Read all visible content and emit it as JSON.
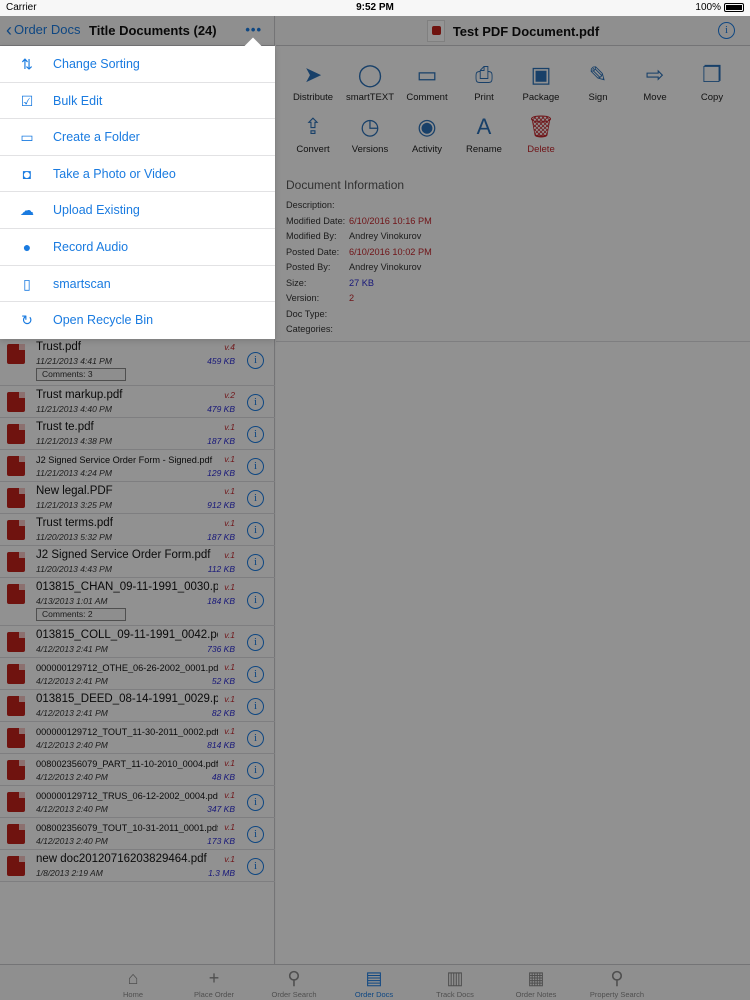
{
  "status": {
    "carrier": "Carrier",
    "time": "9:52 PM",
    "battery": "100%"
  },
  "left_nav": {
    "back_label": "Order Docs",
    "title": "Title Documents (24)",
    "more": "•••"
  },
  "menu": [
    {
      "label": "Change Sorting",
      "icon": "sort-icon"
    },
    {
      "label": "Bulk Edit",
      "icon": "edit-icon"
    },
    {
      "label": "Create a Folder",
      "icon": "folder-icon"
    },
    {
      "label": "Take a Photo or Video",
      "icon": "camera-icon"
    },
    {
      "label": "Upload Existing",
      "icon": "cloud-upload-icon"
    },
    {
      "label": "Record Audio",
      "icon": "microphone-icon"
    },
    {
      "label": "smartscan",
      "icon": "phone-icon"
    },
    {
      "label": "Open Recycle Bin",
      "icon": "recycle-icon"
    }
  ],
  "documents": [
    {
      "name": "Trust.pdf",
      "date": "11/21/2013 4:41 PM",
      "version": "v.4",
      "size": "459 KB",
      "comments": "Comments: 3"
    },
    {
      "name": "Trust markup.pdf",
      "date": "11/21/2013 4:40 PM",
      "version": "v.2",
      "size": "479 KB"
    },
    {
      "name": "Trust te.pdf",
      "date": "11/21/2013 4:38 PM",
      "version": "v.1",
      "size": "187 KB"
    },
    {
      "name": "J2 Signed Service Order Form - Signed.pdf",
      "date": "11/21/2013 4:24 PM",
      "version": "v.1",
      "size": "129 KB",
      "small": true
    },
    {
      "name": "New legal.PDF",
      "date": "11/21/2013 3:25 PM",
      "version": "v.1",
      "size": "912 KB"
    },
    {
      "name": "Trust terms.pdf",
      "date": "11/20/2013 5:32 PM",
      "version": "v.1",
      "size": "187 KB"
    },
    {
      "name": "J2 Signed Service Order Form.pdf",
      "date": "11/20/2013 4:43 PM",
      "version": "v.1",
      "size": "112 KB"
    },
    {
      "name": "013815_CHAN_09-11-1991_0030.pdf",
      "date": "4/13/2013 1:01 AM",
      "version": "v.1",
      "size": "184 KB",
      "comments": "Comments: 2"
    },
    {
      "name": "013815_COLL_09-11-1991_0042.pdf",
      "date": "4/12/2013 2:41 PM",
      "version": "v.1",
      "size": "736 KB"
    },
    {
      "name": "000000129712_OTHE_06-26-2002_0001.pdf",
      "date": "4/12/2013 2:41 PM",
      "version": "v.1",
      "size": "52 KB",
      "small": true
    },
    {
      "name": "013815_DEED_08-14-1991_0029.pdf",
      "date": "4/12/2013 2:41 PM",
      "version": "v.1",
      "size": "82 KB"
    },
    {
      "name": "000000129712_TOUT_11-30-2011_0002.pdf",
      "date": "4/12/2013 2:40 PM",
      "version": "v.1",
      "size": "814 KB",
      "small": true
    },
    {
      "name": "008002356079_PART_11-10-2010_0004.pdf",
      "date": "4/12/2013 2:40 PM",
      "version": "v.1",
      "size": "48 KB",
      "small": true
    },
    {
      "name": "000000129712_TRUS_06-12-2002_0004.pdf",
      "date": "4/12/2013 2:40 PM",
      "version": "v.1",
      "size": "347 KB",
      "small": true
    },
    {
      "name": "008002356079_TOUT_10-31-2011_0001.pdf",
      "date": "4/12/2013 2:40 PM",
      "version": "v.1",
      "size": "173 KB",
      "small": true
    },
    {
      "name": "new doc20120716203829464.pdf",
      "date": "1/8/2013 2:19 AM",
      "version": "v.1",
      "size": "1.3 MB"
    }
  ],
  "right_nav": {
    "doc_title": "Test PDF Document.pdf"
  },
  "tools": [
    {
      "label": "Distribute",
      "icon": "paper-plane-icon",
      "glyph": "➤"
    },
    {
      "label": "smartTEXT",
      "icon": "chat-bubble-icon",
      "glyph": "◯"
    },
    {
      "label": "Comment",
      "icon": "comment-icon",
      "glyph": "▭"
    },
    {
      "label": "Print",
      "icon": "printer-icon",
      "glyph": "⎙"
    },
    {
      "label": "Package",
      "icon": "briefcase-icon",
      "glyph": "▣"
    },
    {
      "label": "Sign",
      "icon": "pen-icon",
      "glyph": "✎"
    },
    {
      "label": "Move",
      "icon": "move-icon",
      "glyph": "⇨"
    },
    {
      "label": "Copy",
      "icon": "copy-icon",
      "glyph": "❐"
    },
    {
      "label": "Convert",
      "icon": "share-icon",
      "glyph": "⇪"
    },
    {
      "label": "Versions",
      "icon": "clock-icon",
      "glyph": "◷"
    },
    {
      "label": "Activity",
      "icon": "eye-icon",
      "glyph": "◉"
    },
    {
      "label": "Rename",
      "icon": "rename-icon",
      "glyph": "A"
    },
    {
      "label": "Delete",
      "icon": "trash-icon",
      "glyph": "🗑"
    }
  ],
  "doc_info": {
    "heading": "Document Information",
    "rows": [
      {
        "key": "Description:",
        "value": ""
      },
      {
        "key": "Modified Date:",
        "value": "6/10/2016 10:16 PM",
        "style": "red"
      },
      {
        "key": "Modified By:",
        "value": "Andrey Vinokurov"
      },
      {
        "key": "Posted Date:",
        "value": "6/10/2016 10:02 PM",
        "style": "red"
      },
      {
        "key": "Posted By:",
        "value": "Andrey Vinokurov"
      },
      {
        "key": "Size:",
        "value": "27 KB",
        "style": "blue"
      },
      {
        "key": "Version:",
        "value": "2",
        "style": "red"
      },
      {
        "key": "Doc Type:",
        "value": ""
      },
      {
        "key": "Categories:",
        "value": ""
      }
    ]
  },
  "tabs": [
    {
      "label": "Home",
      "icon": "home-icon",
      "glyph": "⌂"
    },
    {
      "label": "Place Order",
      "icon": "plus-icon",
      "glyph": "+"
    },
    {
      "label": "Order Search",
      "icon": "search-icon",
      "glyph": "⚲"
    },
    {
      "label": "Order Docs",
      "icon": "document-icon",
      "glyph": "▤",
      "active": true
    },
    {
      "label": "Track Docs",
      "icon": "tracker-icon",
      "glyph": "▥"
    },
    {
      "label": "Order Notes",
      "icon": "notes-icon",
      "glyph": "▦"
    },
    {
      "label": "Property Search",
      "icon": "property-search-icon",
      "glyph": "⚲"
    }
  ]
}
